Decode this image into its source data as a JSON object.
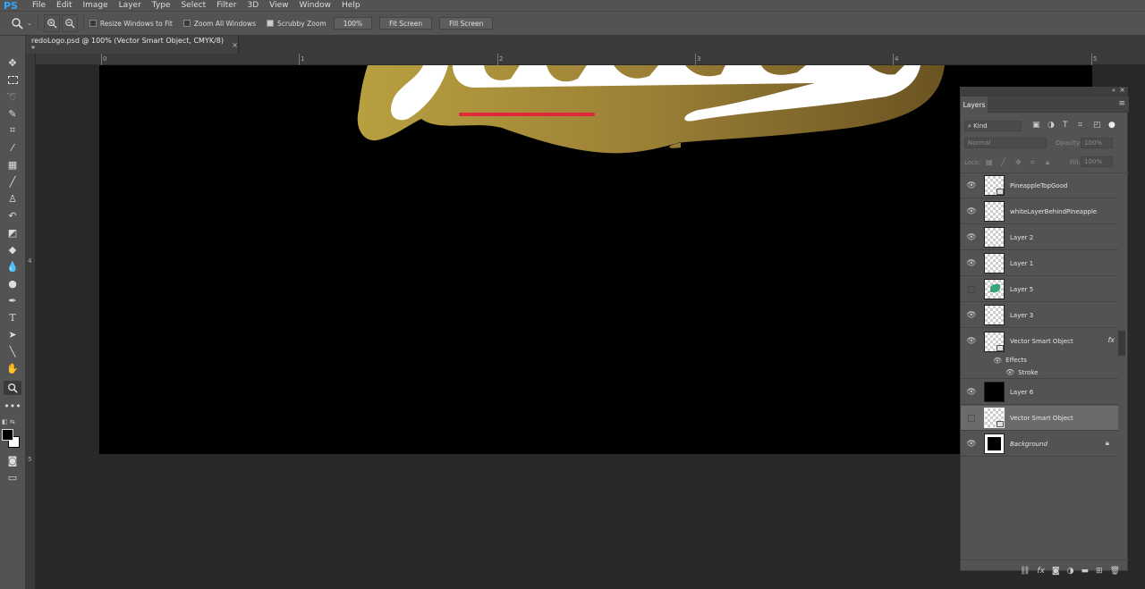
{
  "app": {
    "logo": "PS"
  },
  "menu": [
    "File",
    "Edit",
    "Image",
    "Layer",
    "Type",
    "Select",
    "Filter",
    "3D",
    "View",
    "Window",
    "Help"
  ],
  "options": {
    "resize_windows": "Resize Windows to Fit",
    "zoom_all": "Zoom All Windows",
    "scrubby": "Scrubby Zoom",
    "zoom_value": "100%",
    "fit_screen": "Fit Screen",
    "fill_screen": "Fill Screen"
  },
  "document": {
    "tab_title": "redoLogo.psd @ 100% (Vector Smart Object, CMYK/8) *",
    "close": "×"
  },
  "ruler": {
    "h": [
      "0",
      "1",
      "2",
      "3",
      "4",
      "5"
    ],
    "v": [
      "4",
      "5"
    ]
  },
  "layers_panel": {
    "title": "Layers",
    "filter": "Kind",
    "blend_mode": "Normal",
    "opacity_label": "Opacity:",
    "opacity_value": "100%",
    "lock_label": "Lock:",
    "fill_label": "Fill:",
    "fill_value": "100%",
    "fx": "fx",
    "effects": "Effects",
    "stroke": "Stroke",
    "layers": [
      {
        "name": "PineappleTopGood"
      },
      {
        "name": "whiteLayerBehindPineapple"
      },
      {
        "name": "Layer 2"
      },
      {
        "name": "Layer 1"
      },
      {
        "name": "Layer 5"
      },
      {
        "name": "Layer 3"
      },
      {
        "name": "Vector Smart Object"
      },
      {
        "name": "Layer 6"
      },
      {
        "name": "Vector Smart Object"
      },
      {
        "name": "Background"
      }
    ]
  },
  "colors": {
    "accent": "#31a8ff",
    "gold": "#b8a040",
    "brown": "#6b5322",
    "red_line": "#e0283a"
  }
}
